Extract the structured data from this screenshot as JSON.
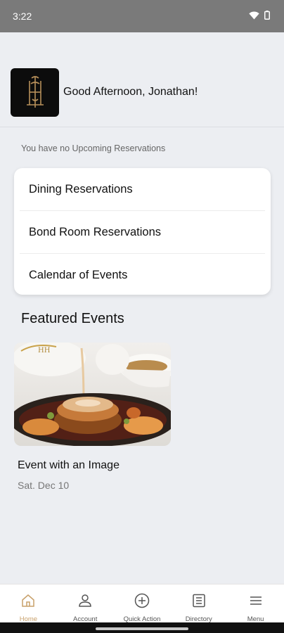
{
  "status_bar": {
    "time": "3:22",
    "wifi_icon": "wifi-icon",
    "battery_icon": "battery-icon"
  },
  "header": {
    "logo_icon": "club-logo-icon",
    "greeting": "Good Afternoon, Jonathan!"
  },
  "reservations": {
    "empty_text": "You have no Upcoming Reservations"
  },
  "quick_links": [
    {
      "label": "Dining Reservations"
    },
    {
      "label": "Bond Room Reservations"
    },
    {
      "label": "Calendar of Events"
    }
  ],
  "featured": {
    "title": "Featured Events",
    "events": [
      {
        "title": "Event with an Image",
        "date": "Sat. Dec 10",
        "image": "plated-dessert-photo"
      }
    ]
  },
  "bottom_nav": [
    {
      "label": "Home",
      "icon": "home-icon",
      "active": true
    },
    {
      "label": "Account",
      "icon": "person-icon",
      "active": false
    },
    {
      "label": "Quick Action",
      "icon": "plus-circle-icon",
      "active": false
    },
    {
      "label": "Directory",
      "icon": "list-icon",
      "active": false
    },
    {
      "label": "Menu",
      "icon": "hamburger-icon",
      "active": false
    }
  ],
  "colors": {
    "accent": "#c8a06a",
    "status_bar": "#7a7a7a",
    "background": "#eceef2"
  }
}
